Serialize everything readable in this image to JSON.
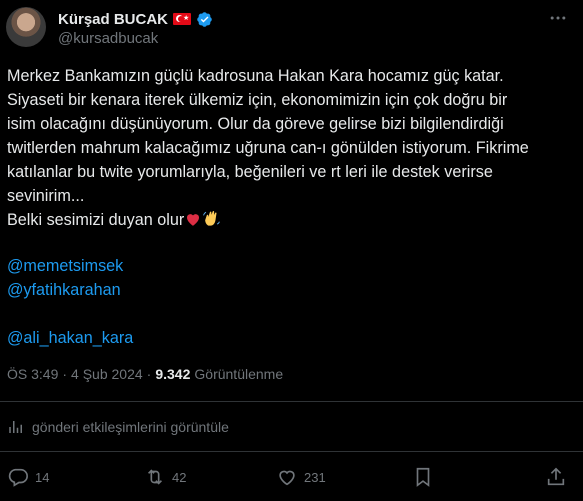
{
  "author": {
    "name": "Kürşad BUCAK",
    "handle": "@kursadbucak"
  },
  "tweet": {
    "text": "Merkez Bankamızın güçlü kadrosuna Hakan Kara hocamız güç katar.\nSiyaseti bir kenara iterek ülkemiz için, ekonomimizin için çok doğru bir\nisim olacağını düşünüyorum. Olur da göreve gelirse bizi bilgilendirdiği\ntwitlerden mahrum kalacağımız uğruna can-ı gönülden istiyorum. Fikrime\nkatılanlar bu twite yorumlarıyla, beğenileri ve rt leri ile destek verirse\nsevinirim...",
    "last_line": "Belki sesimizi duyan olur",
    "last_line_emojis": [
      "red-heart",
      "waving-hand"
    ],
    "mentions": [
      "@memetsimsek",
      "@yfatihkarahan",
      "@ali_hakan_kara"
    ]
  },
  "meta": {
    "time": "ÖS 3:49",
    "separator": "·",
    "date": "4 Şub 2024",
    "views_count": "9.342",
    "views_label": "Görüntülenme"
  },
  "engagements_link": "gönderi etkileşimlerini görüntüle",
  "actions": {
    "replies": "14",
    "reposts": "42",
    "likes": "231"
  },
  "colors": {
    "background": "#000000",
    "text": "#e7e9ea",
    "secondary": "#71767b",
    "link": "#1d9bf0",
    "divider": "#2f3336"
  }
}
